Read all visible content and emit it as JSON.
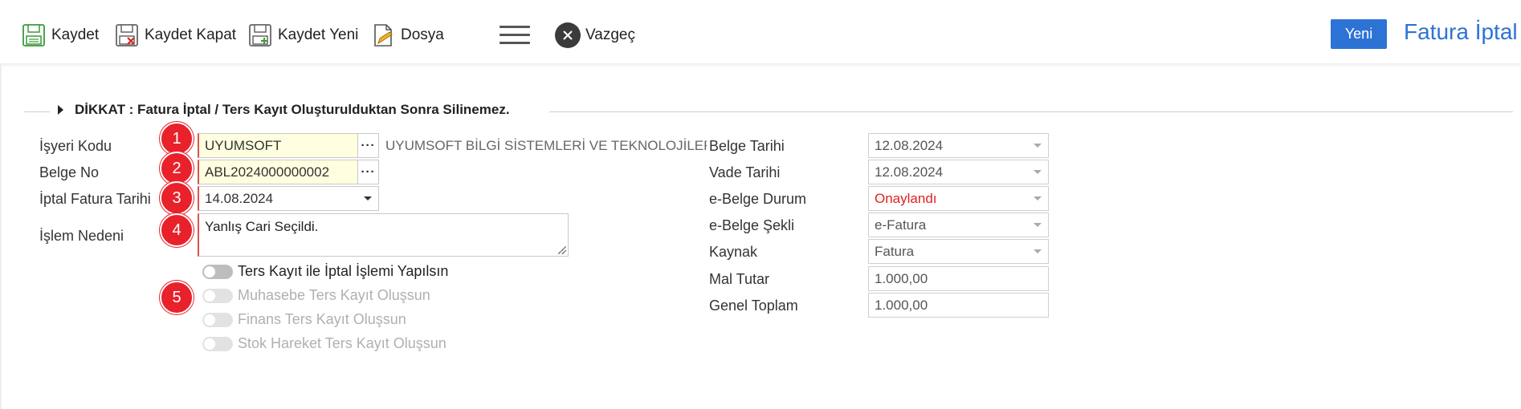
{
  "toolbar": {
    "save": "Kaydet",
    "save_close": "Kaydet Kapat",
    "save_new": "Kaydet Yeni",
    "file": "Dosya",
    "cancel": "Vazgeç",
    "new": "Yeni",
    "title": "Fatura İptal"
  },
  "notice": "DİKKAT : Fatura İptal / Ters Kayıt Oluşturulduktan Sonra Silinemez.",
  "left_form": {
    "workplace_label": "İşyeri Kodu",
    "workplace_value": "UYUMSOFT",
    "workplace_desc": "UYUMSOFT BİLGİ SİSTEMLERİ VE TEKNOLOJİLERİ TİC. A.Ş.",
    "doc_no_label": "Belge No",
    "doc_no_value": "ABL2024000000002",
    "cancel_date_label": "İptal Fatura Tarihi",
    "cancel_date_value": "14.08.2024",
    "reason_label": "İşlem Nedeni",
    "reason_value": "Yanlış Cari Seçildi."
  },
  "toggles": [
    {
      "label": "Ters Kayıt ile İptal İşlemi Yapılsın",
      "enabled": true
    },
    {
      "label": "Muhasebe Ters Kayıt Oluşsun",
      "enabled": false
    },
    {
      "label": "Finans Ters Kayıt Oluşsun",
      "enabled": false
    },
    {
      "label": "Stok Hareket Ters Kayıt Oluşsun",
      "enabled": false
    }
  ],
  "markers": [
    "1",
    "2",
    "3",
    "4",
    "5"
  ],
  "right_form": {
    "doc_date_label": "Belge Tarihi",
    "doc_date_value": "12.08.2024",
    "due_date_label": "Vade Tarihi",
    "due_date_value": "12.08.2024",
    "ebelge_status_label": "e-Belge Durum",
    "ebelge_status_value": "Onaylandı",
    "ebelge_type_label": "e-Belge Şekli",
    "ebelge_type_value": "e-Fatura",
    "source_label": "Kaynak",
    "source_value": "Fatura",
    "goods_total_label": "Mal Tutar",
    "goods_total_value": "1.000,00",
    "grand_total_label": "Genel Toplam",
    "grand_total_value": "1.000,00"
  },
  "colors": {
    "accent": "#2d73d6",
    "marker": "#e8212b",
    "approved": "#e02020"
  }
}
